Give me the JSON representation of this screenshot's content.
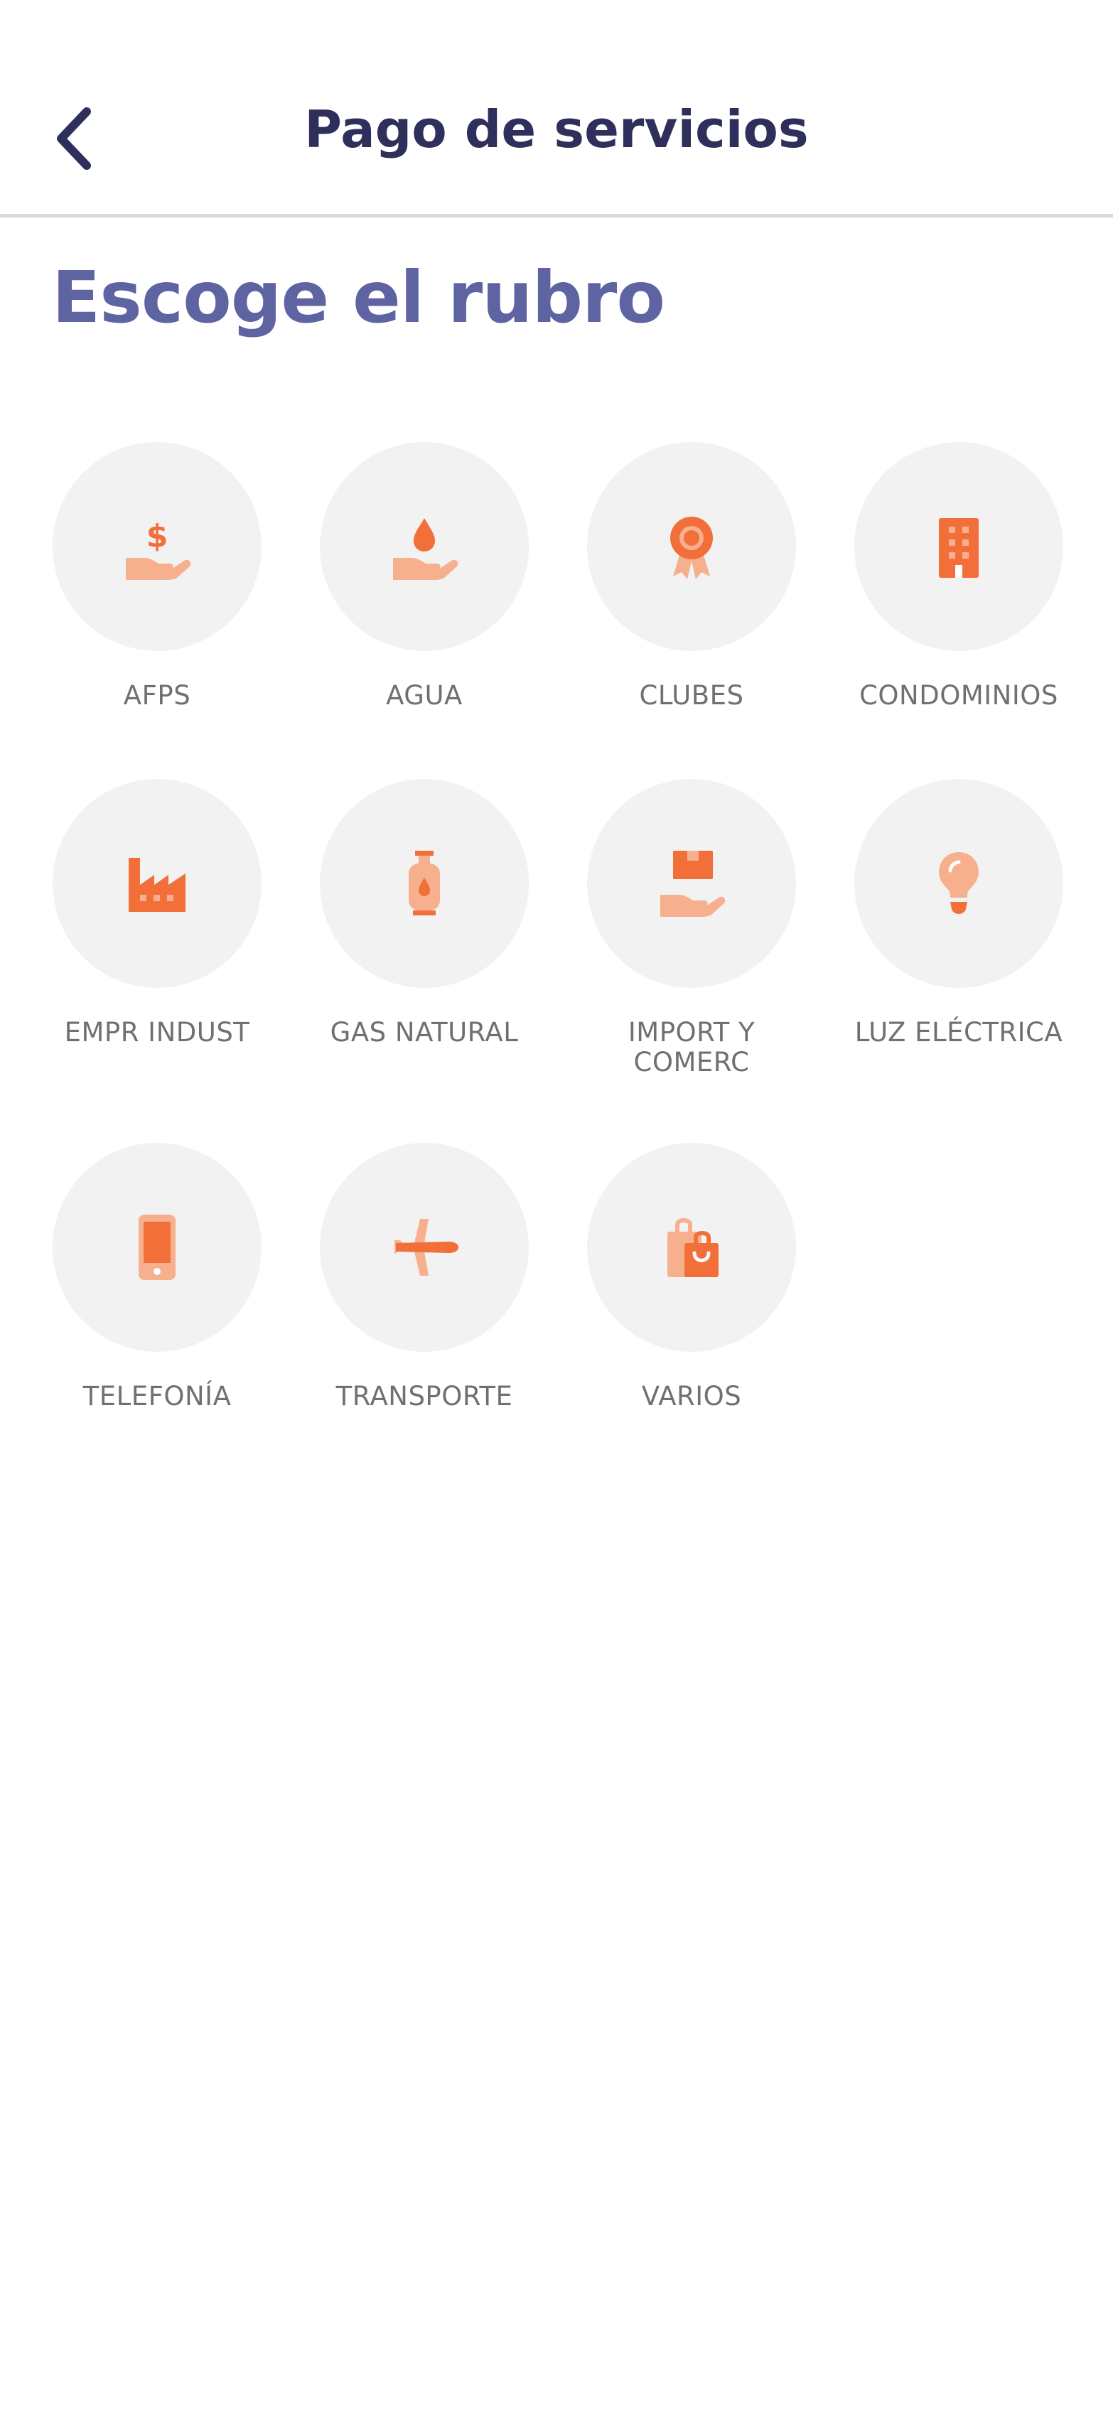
{
  "header": {
    "title": "Pago de servicios",
    "back_icon": "chevron-left-icon"
  },
  "section_title": "Escoge el rubro",
  "colors": {
    "icon_primary": "#f26f3a",
    "icon_secondary": "#f7b08e",
    "circle_bg": "#f2f2f2",
    "title": "#2e2f5b",
    "section_title": "#5e63a2",
    "label": "#707070"
  },
  "categories": [
    {
      "label": "AFPS",
      "icon": "hand-money-icon"
    },
    {
      "label": "AGUA",
      "icon": "hand-water-drop-icon"
    },
    {
      "label": "CLUBES",
      "icon": "badge-ribbon-icon"
    },
    {
      "label": "CONDOMINIOS",
      "icon": "building-icon"
    },
    {
      "label": "EMPR INDUST",
      "icon": "factory-icon"
    },
    {
      "label": "GAS NATURAL",
      "icon": "gas-cylinder-icon"
    },
    {
      "label": "IMPORT Y\nCOMERC",
      "icon": "hand-package-icon"
    },
    {
      "label": "LUZ ELÉCTRICA",
      "icon": "light-bulb-icon"
    },
    {
      "label": "TELEFONÍA",
      "icon": "mobile-phone-icon"
    },
    {
      "label": "TRANSPORTE",
      "icon": "airplane-icon"
    },
    {
      "label": "VARIOS",
      "icon": "shopping-bags-icon"
    }
  ]
}
